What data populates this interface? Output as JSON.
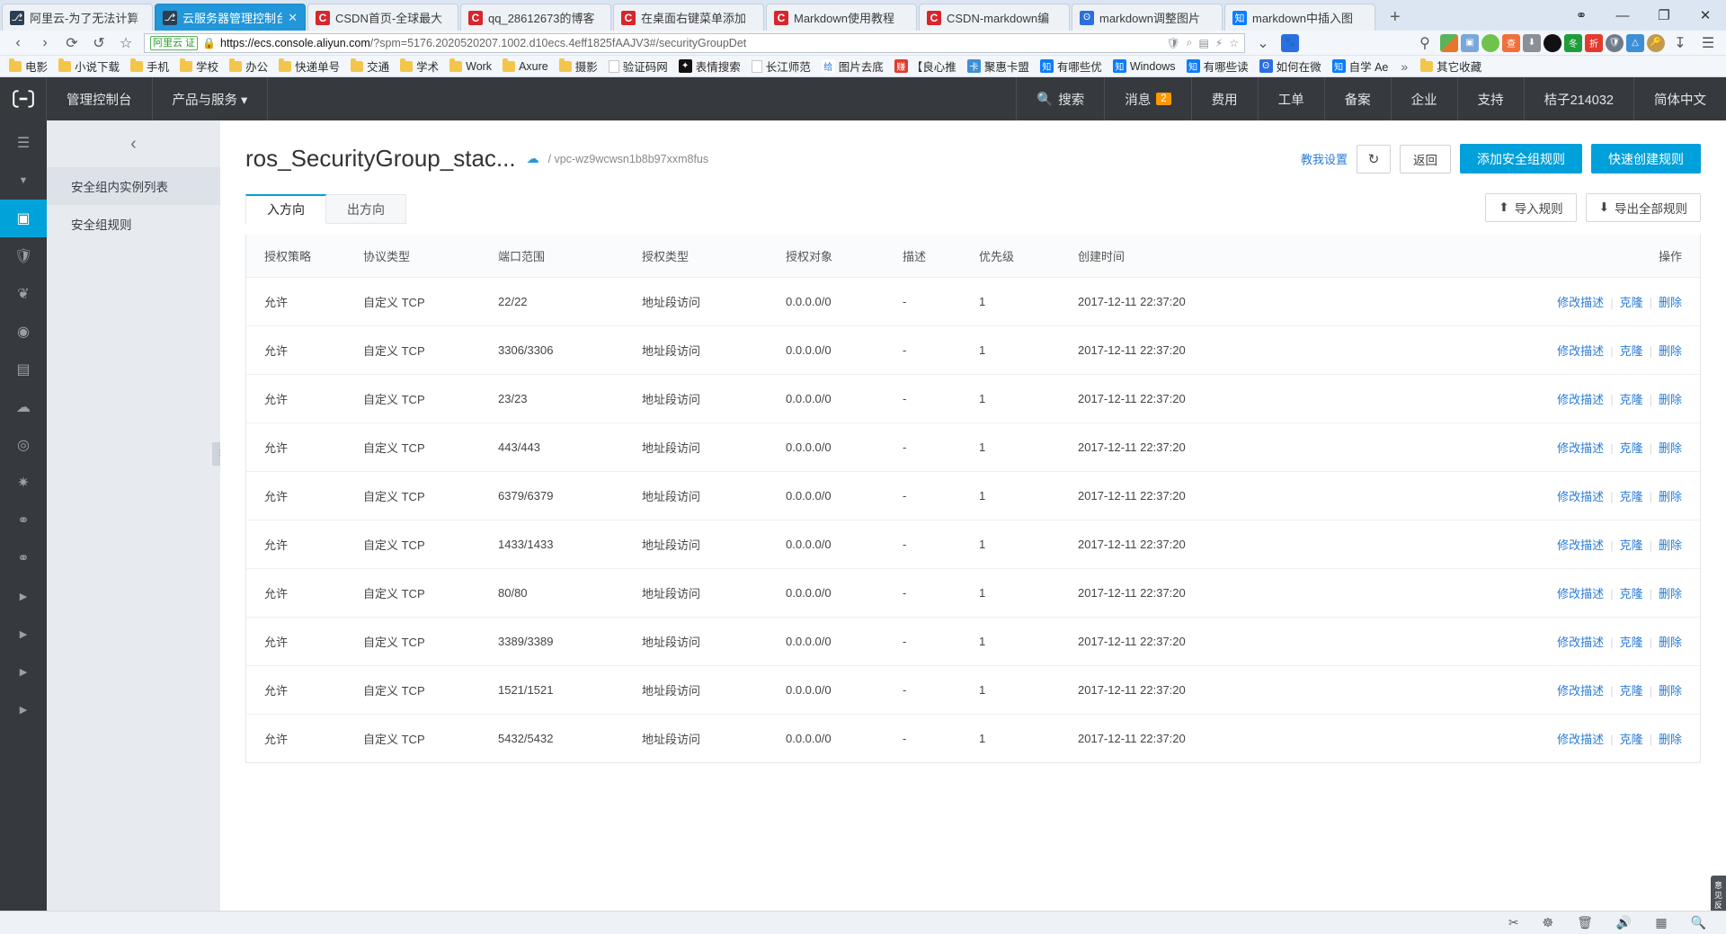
{
  "browser": {
    "tabs": [
      {
        "title": "阿里云-为了无法计算",
        "favicon": "aliyun-icon",
        "active": false
      },
      {
        "title": "云服务器管理控制台",
        "favicon": "aliyun-icon",
        "active": true
      },
      {
        "title": "CSDN首页-全球最大",
        "favicon": "csdn-icon",
        "active": false
      },
      {
        "title": "qq_28612673的博客",
        "favicon": "csdn-icon",
        "active": false
      },
      {
        "title": "在桌面右键菜单添加",
        "favicon": "csdn-icon",
        "active": false
      },
      {
        "title": "Markdown使用教程",
        "favicon": "csdn-icon",
        "active": false
      },
      {
        "title": "CSDN-markdown编",
        "favicon": "csdn-icon",
        "active": false
      },
      {
        "title": "markdown调整图片",
        "favicon": "baidu-icon",
        "active": false
      },
      {
        "title": "markdown中插入图",
        "favicon": "zhihu-icon",
        "active": false
      }
    ],
    "new_tab_label": "+",
    "window_controls": {
      "restore": "❐",
      "minimize": "—",
      "maximize": "▭",
      "close": "✕"
    },
    "nav": {
      "back": "‹",
      "forward": "›",
      "reload": "⟳",
      "history": "↺",
      "bookmark": "☆"
    },
    "address": {
      "seal_label": "阿里云 证",
      "lock": "lock-icon",
      "url_host": "https://ecs.console.aliyun.com",
      "url_rest": "/?spm=5176.2020520207.1002.d10ecs.4eff1825fAAJV3#/securityGroupDet",
      "shield": "shield-icon",
      "zoom_glass": "⌕",
      "qr": "▤",
      "lightning": "⚡",
      "star": "☆",
      "chevron": "⌄"
    },
    "bookmarks": [
      {
        "label": "电影",
        "icon": "folder-icon"
      },
      {
        "label": "小说下载",
        "icon": "folder-icon"
      },
      {
        "label": "手机",
        "icon": "folder-icon"
      },
      {
        "label": "学校",
        "icon": "folder-icon"
      },
      {
        "label": "办公",
        "icon": "folder-icon"
      },
      {
        "label": "快递单号",
        "icon": "folder-icon"
      },
      {
        "label": "交通",
        "icon": "folder-icon"
      },
      {
        "label": "学术",
        "icon": "folder-icon"
      },
      {
        "label": "Work",
        "icon": "folder-icon"
      },
      {
        "label": "Axure",
        "icon": "folder-icon"
      },
      {
        "label": "摄影",
        "icon": "folder-icon"
      },
      {
        "label": "验证码网",
        "icon": "page-icon"
      },
      {
        "label": "表情搜索",
        "icon": "dark-icon"
      },
      {
        "label": "长江师范",
        "icon": "page-icon"
      },
      {
        "label": "图片去底",
        "icon": "gei-icon"
      },
      {
        "label": "【良心推",
        "icon": "zhuan-icon"
      },
      {
        "label": "聚惠卡盟",
        "icon": "ka-icon"
      },
      {
        "label": "有哪些优",
        "icon": "zhihu-icon"
      },
      {
        "label": "Windows",
        "icon": "zhihu-icon"
      },
      {
        "label": "有哪些读",
        "icon": "zhihu-icon"
      },
      {
        "label": "如何在微",
        "icon": "baidu-icon"
      },
      {
        "label": "自学 Ae",
        "icon": "zhihu-icon"
      }
    ],
    "bookmarks_overflow": "»",
    "other_bookmarks": "其它收藏"
  },
  "console": {
    "topnav": {
      "logo": "aliyun-logo-icon",
      "left_items": [
        "管理控制台",
        "产品与服务 ▾"
      ],
      "search": "搜索",
      "messages": {
        "label": "消息",
        "count": "2"
      },
      "right_items": [
        "费用",
        "工单",
        "备案",
        "企业",
        "支持",
        "桔子214032",
        "简体中文"
      ]
    },
    "left_rail": {
      "icons": [
        "menu-icon",
        "chevron-down-icon",
        "server-icon",
        "shield-icon",
        "network-icon",
        "storage-icon",
        "snapshot-icon",
        "image-icon",
        "target-icon",
        "deploy-icon",
        "link-icon",
        "link2-icon",
        "arrow-right-icon-1",
        "arrow-right-icon-2",
        "arrow-right-icon-3",
        "arrow-right-icon-4"
      ],
      "selected_index": 2
    },
    "sidebar": {
      "collapse": "‹",
      "items": [
        {
          "label": "安全组内实例列表",
          "active": true
        },
        {
          "label": "安全组规则",
          "active": false
        }
      ],
      "rail_handle": "⫶"
    },
    "page": {
      "title": "ros_SecurityGroup_stac...",
      "cloud_icon": "cloud-icon",
      "vpc_id": "/ vpc-wz9wcwsn1b8b97xxm8fus",
      "teach_link": "教我设置",
      "refresh_icon": "refresh-icon",
      "back_button": "返回",
      "add_rule_button": "添加安全组规则",
      "quick_create_button": "快速创建规则"
    },
    "tabs": [
      {
        "label": "入方向",
        "active": true
      },
      {
        "label": "出方向",
        "active": false
      }
    ],
    "toolbar": {
      "import_label": "导入规则",
      "import_icon": "upload-icon",
      "export_label": "导出全部规则",
      "export_icon": "download-icon"
    },
    "table": {
      "columns": [
        "授权策略",
        "协议类型",
        "端口范围",
        "授权类型",
        "授权对象",
        "描述",
        "优先级",
        "创建时间",
        "操作"
      ],
      "ops": {
        "edit": "修改描述",
        "clone": "克隆",
        "delete": "删除",
        "sep": "|"
      },
      "rows": [
        {
          "policy": "允许",
          "protocol": "自定义 TCP",
          "port": "22/22",
          "auth_type": "地址段访问",
          "auth_object": "0.0.0.0/0",
          "desc": "-",
          "priority": "1",
          "created": "2017-12-11 22:37:20"
        },
        {
          "policy": "允许",
          "protocol": "自定义 TCP",
          "port": "3306/3306",
          "auth_type": "地址段访问",
          "auth_object": "0.0.0.0/0",
          "desc": "-",
          "priority": "1",
          "created": "2017-12-11 22:37:20"
        },
        {
          "policy": "允许",
          "protocol": "自定义 TCP",
          "port": "23/23",
          "auth_type": "地址段访问",
          "auth_object": "0.0.0.0/0",
          "desc": "-",
          "priority": "1",
          "created": "2017-12-11 22:37:20"
        },
        {
          "policy": "允许",
          "protocol": "自定义 TCP",
          "port": "443/443",
          "auth_type": "地址段访问",
          "auth_object": "0.0.0.0/0",
          "desc": "-",
          "priority": "1",
          "created": "2017-12-11 22:37:20"
        },
        {
          "policy": "允许",
          "protocol": "自定义 TCP",
          "port": "6379/6379",
          "auth_type": "地址段访问",
          "auth_object": "0.0.0.0/0",
          "desc": "-",
          "priority": "1",
          "created": "2017-12-11 22:37:20"
        },
        {
          "policy": "允许",
          "protocol": "自定义 TCP",
          "port": "1433/1433",
          "auth_type": "地址段访问",
          "auth_object": "0.0.0.0/0",
          "desc": "-",
          "priority": "1",
          "created": "2017-12-11 22:37:20"
        },
        {
          "policy": "允许",
          "protocol": "自定义 TCP",
          "port": "80/80",
          "auth_type": "地址段访问",
          "auth_object": "0.0.0.0/0",
          "desc": "-",
          "priority": "1",
          "created": "2017-12-11 22:37:20"
        },
        {
          "policy": "允许",
          "protocol": "自定义 TCP",
          "port": "3389/3389",
          "auth_type": "地址段访问",
          "auth_object": "0.0.0.0/0",
          "desc": "-",
          "priority": "1",
          "created": "2017-12-11 22:37:20"
        },
        {
          "policy": "允许",
          "protocol": "自定义 TCP",
          "port": "1521/1521",
          "auth_type": "地址段访问",
          "auth_object": "0.0.0.0/0",
          "desc": "-",
          "priority": "1",
          "created": "2017-12-11 22:37:20"
        },
        {
          "policy": "允许",
          "protocol": "自定义 TCP",
          "port": "5432/5432",
          "auth_type": "地址段访问",
          "auth_object": "0.0.0.0/0",
          "desc": "-",
          "priority": "1",
          "created": "2017-12-11 22:37:20"
        }
      ]
    },
    "side_tab": "意见反馈"
  },
  "statusbar": {
    "icons": [
      "screenshot-icon",
      "translate-icon",
      "trash-icon",
      "speaker-icon",
      "window-icon",
      "search-icon"
    ]
  }
}
